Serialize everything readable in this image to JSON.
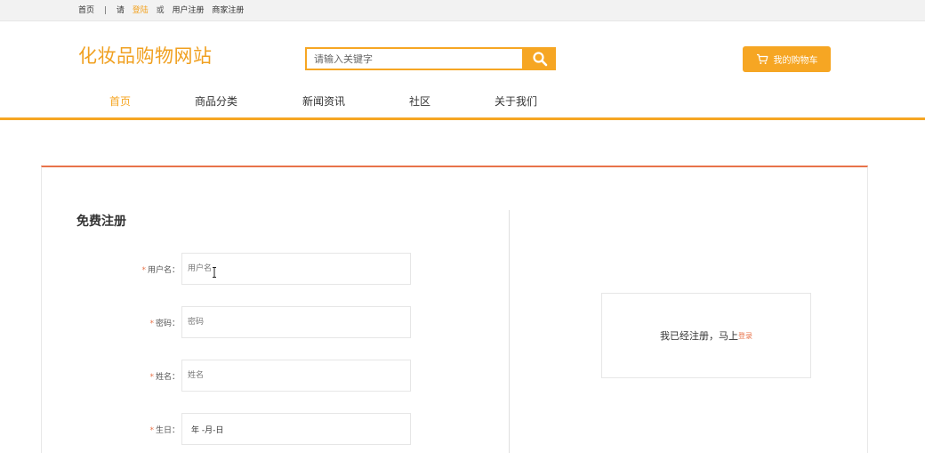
{
  "topbar": {
    "home": "首页",
    "separator": "|",
    "please": "请",
    "login": "登陆",
    "or": "或",
    "user_register": "用户注册",
    "merchant_register": "商家注册"
  },
  "header": {
    "site_title": "化妆品购物网站",
    "search_placeholder": "请输入关键字",
    "cart_label": "我的购物车"
  },
  "nav": {
    "items": [
      {
        "label": "首页",
        "active": true
      },
      {
        "label": "商品分类",
        "active": false
      },
      {
        "label": "新闻资讯",
        "active": false
      },
      {
        "label": "社区",
        "active": false
      },
      {
        "label": "关于我们",
        "active": false
      }
    ]
  },
  "form": {
    "title": "免费注册",
    "required_mark": "*",
    "fields": [
      {
        "label": "用户名：",
        "placeholder": "用户名"
      },
      {
        "label": "密码：",
        "placeholder": "密码"
      },
      {
        "label": "姓名：",
        "placeholder": "姓名"
      },
      {
        "label": "生日：",
        "value": "年 -月-日"
      }
    ]
  },
  "login_box": {
    "text": "我已经注册，马上",
    "link": "登录"
  },
  "colors": {
    "accent": "#f6a623",
    "title": "#f0a020",
    "highlight": "#e8734a"
  },
  "icons": {
    "search": "search-icon",
    "cart": "cart-icon",
    "cursor": "text-cursor-icon"
  }
}
